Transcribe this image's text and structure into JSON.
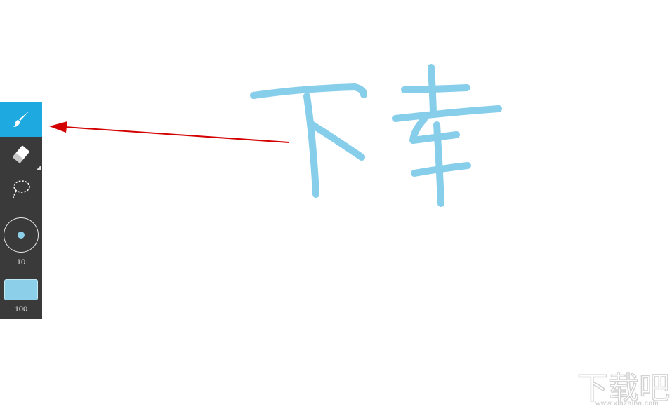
{
  "toolbar": {
    "tools": [
      {
        "name": "brush",
        "icon": "brush-icon",
        "active": true
      },
      {
        "name": "eraser",
        "icon": "eraser-icon",
        "active": false
      },
      {
        "name": "lasso",
        "icon": "lasso-select-icon",
        "active": false
      }
    ],
    "brush_size": "10",
    "opacity": "100",
    "color": "#8ccfe8",
    "active_color": "#1fa9e1"
  },
  "canvas": {
    "handwritten_text": "下载",
    "stroke_color": "#87ceea",
    "annotation_arrow_color": "#d40000"
  },
  "watermark": {
    "text": "下载吧",
    "url": "www.xiazaiba.com"
  }
}
